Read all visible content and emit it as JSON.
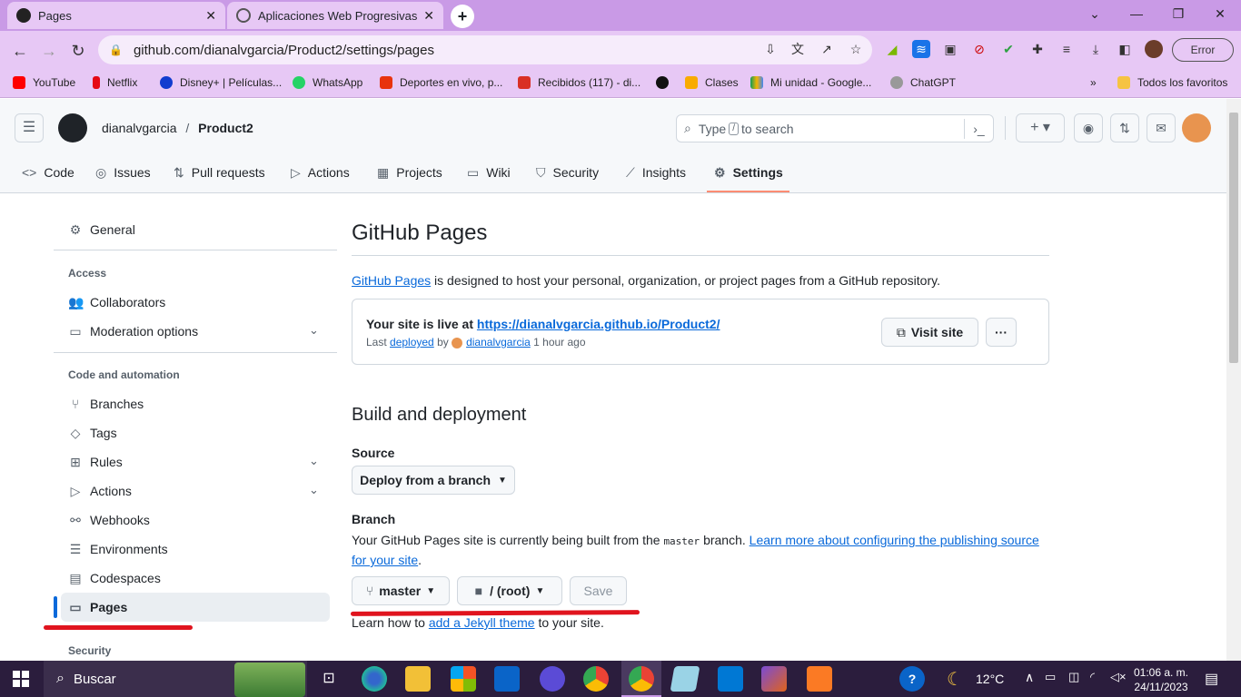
{
  "browser": {
    "tabs": [
      {
        "title": "Pages"
      },
      {
        "title": "Aplicaciones Web Progresivas"
      }
    ],
    "url": "github.com/dianalvgarcia/Product2/settings/pages",
    "error_label": "Error",
    "bookmarks": [
      "YouTube",
      "Netflix",
      "Disney+ | Películas...",
      "WhatsApp",
      "Deportes en vivo, p...",
      "Recibidos (117) - di...",
      "",
      "Clases",
      "Mi unidad - Google...",
      "ChatGPT"
    ],
    "all_favorites": "Todos los favoritos"
  },
  "github": {
    "owner": "dianalvgarcia",
    "sep": "/",
    "repo": "Product2",
    "search_pre": "Type",
    "search_key": "/",
    "search_post": "to search",
    "nav": [
      "Code",
      "Issues",
      "Pull requests",
      "Actions",
      "Projects",
      "Wiki",
      "Security",
      "Insights",
      "Settings"
    ]
  },
  "sidebar": {
    "general": "General",
    "access_heading": "Access",
    "collaborators": "Collaborators",
    "moderation": "Moderation options",
    "code_heading": "Code and automation",
    "branches": "Branches",
    "tags": "Tags",
    "rules": "Rules",
    "actions": "Actions",
    "webhooks": "Webhooks",
    "environments": "Environments",
    "codespaces": "Codespaces",
    "pages": "Pages",
    "security_heading": "Security"
  },
  "main": {
    "title": "GitHub Pages",
    "intro_link": "GitHub Pages",
    "intro_text": " is designed to host your personal, organization, or project pages from a GitHub repository.",
    "live_prefix": "Your site is live at ",
    "live_url": "https://dianalvgarcia.github.io/Product2/",
    "last": "Last ",
    "deployed": "deployed",
    "by": " by ",
    "user": "dianalvgarcia",
    "ago": " 1 hour ago",
    "visit_site": "Visit site",
    "more": "···",
    "build_title": "Build and deployment",
    "source_label": "Source",
    "source_value": "Deploy from a branch",
    "branch_label": "Branch",
    "branch_text1": "Your GitHub Pages site is currently being built from the ",
    "branch_code": "master",
    "branch_text2": " branch. ",
    "learn_more": "Learn more about configuring the publishing source for your site",
    "period": ".",
    "branch_value": "master",
    "folder_value": "/ (root)",
    "save": "Save",
    "jekyll_pre": "Learn how to ",
    "jekyll_link": "add a Jekyll theme",
    "jekyll_post": " to your site."
  },
  "taskbar": {
    "search": "Buscar",
    "temp": "12°C",
    "time": "01:06 a. m.",
    "date": "24/11/2023"
  },
  "colors": {
    "accent": "#fd8c73",
    "annotation": "#e0141e",
    "tab_bar": "#c99ae6"
  }
}
